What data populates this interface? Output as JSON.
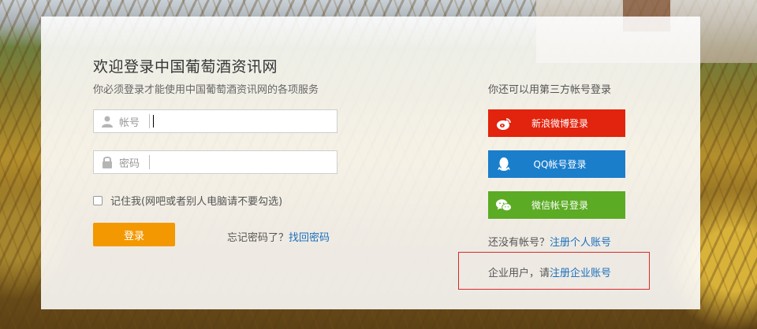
{
  "page": {
    "title": "欢迎登录中国葡萄酒资讯网",
    "subtitle": "你必须登录才能使用中国葡萄酒资讯网的各项服务"
  },
  "form": {
    "username_label": "帐号",
    "username_value": "",
    "username_icon": "user-icon",
    "password_label": "密码",
    "password_value": "",
    "password_icon": "lock-icon",
    "remember_label": "记住我(网吧或者别人电脑请不要勾选)",
    "remember_checked": false,
    "login_button": "登录",
    "forgot_text": "忘记密码了？",
    "forgot_link": "找回密码"
  },
  "third_party": {
    "title": "你还可以用第三方帐号登录",
    "buttons": [
      {
        "label": "新浪微博登录",
        "icon": "weibo-icon",
        "color": "#e2230d"
      },
      {
        "label": "QQ帐号登录",
        "icon": "qq-icon",
        "color": "#1a7ecb"
      },
      {
        "label": "微信帐号登录",
        "icon": "wechat-icon",
        "color": "#5bab24"
      }
    ]
  },
  "register": {
    "no_account_text": "还没有帐号？",
    "personal_link": "注册个人账号",
    "enterprise_text": "企业用户，请",
    "enterprise_link": "注册企业账号"
  },
  "colors": {
    "accent": "#f39800",
    "link": "#1a6fbf",
    "highlight_border": "#d62b2b"
  }
}
